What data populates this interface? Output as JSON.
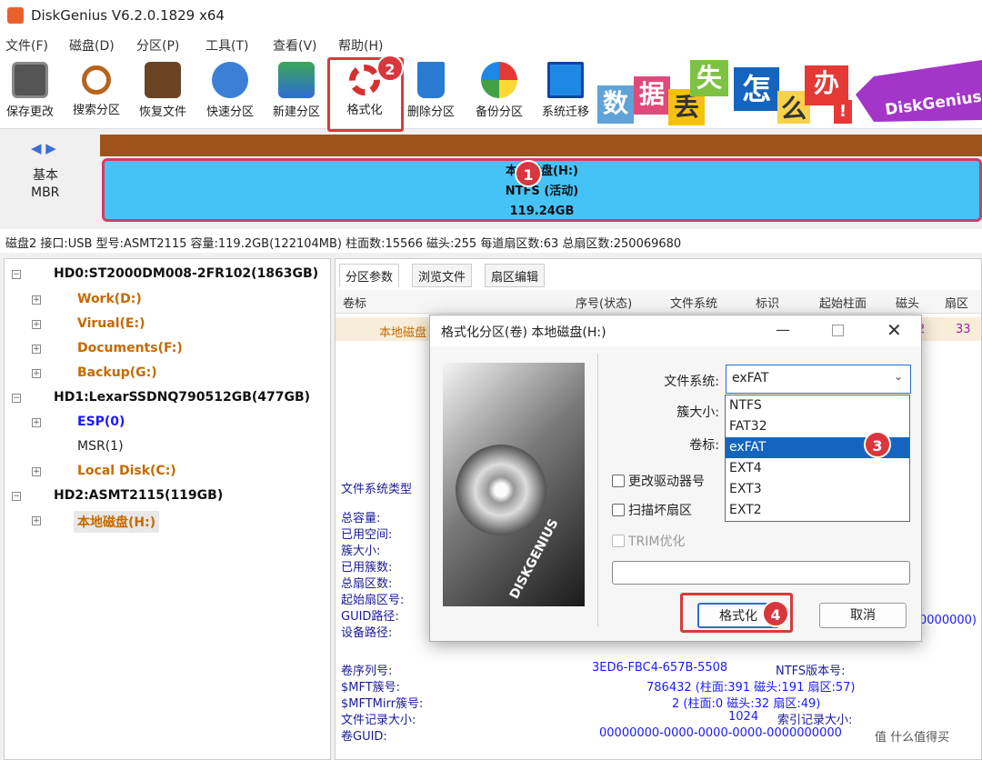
{
  "app": {
    "title": "DiskGenius V6.2.0.1829 x64"
  },
  "menu": [
    "文件(F)",
    "磁盘(D)",
    "分区(P)",
    "工具(T)",
    "查看(V)",
    "帮助(H)"
  ],
  "toolbar": [
    "保存更改",
    "搜索分区",
    "恢复文件",
    "快速分区",
    "新建分区",
    "格式化",
    "删除分区",
    "备份分区",
    "系统迁移"
  ],
  "banner": {
    "chars": [
      "数",
      "据",
      "丢",
      "失",
      "怎",
      "么",
      "办",
      "!"
    ],
    "tag": "DiskGenius"
  },
  "diskmap": {
    "nav": "◀ ▶",
    "type": "基本",
    "scheme": "MBR",
    "part_name": "本地磁盘(H:)",
    "part_fs": "NTFS (活动)",
    "part_size": "119.24GB"
  },
  "info": "磁盘2 接口:USB  型号:ASMT2115  容量:119.2GB(122104MB)  柱面数:15566  磁头:255  每道扇区数:63  总扇区数:250069680",
  "tree": [
    {
      "label": "HD0:ST2000DM008-2FR102(1863GB)",
      "kind": "d"
    },
    {
      "label": "Work(D:)",
      "kind": "o"
    },
    {
      "label": "Virual(E:)",
      "kind": "o"
    },
    {
      "label": "Documents(F:)",
      "kind": "o"
    },
    {
      "label": "Backup(G:)",
      "kind": "o"
    },
    {
      "label": "HD1:LexarSSDNQ790512GB(477GB)",
      "kind": "d"
    },
    {
      "label": "ESP(0)",
      "kind": "b"
    },
    {
      "label": "MSR(1)",
      "kind": "n"
    },
    {
      "label": "Local Disk(C:)",
      "kind": "o"
    },
    {
      "label": "HD2:ASMT2115(119GB)",
      "kind": "d"
    },
    {
      "label": "本地磁盘(H:)",
      "kind": "o"
    }
  ],
  "tabs": [
    "分区参数",
    "浏览文件",
    "扇区编辑"
  ],
  "table": {
    "headers": [
      "卷标",
      "序号(状态)",
      "文件系统",
      "标识",
      "起始柱面",
      "磁头",
      "扇区"
    ],
    "row_label": "本地磁盘",
    "row_cut": "2",
    "row_sector": "33"
  },
  "params_left": [
    "文件系统类型",
    "总容量:",
    "已用空间:",
    "簇大小:",
    "已用簇数:",
    "总扇区数:",
    "起始扇区号:",
    "GUID路径:",
    "设备路径:"
  ],
  "params_bottom": {
    "labels": [
      "卷序列号:",
      "$MFT簇号:",
      "$MFTMirr簇号:",
      "文件记录大小:",
      "卷GUID:"
    ],
    "values": [
      "3ED6-FBC4-657B-5508",
      "786432 (柱面:391 磁头:191 扇区:57)",
      "2 (柱面:0 磁头:32 扇区:49)",
      "1024",
      "00000000-0000-0000-0000-0000000000"
    ],
    "right": [
      "NTFS版本号:",
      "",
      "",
      "索引记录大小:",
      ""
    ],
    "overflow": "0000000)"
  },
  "dialog": {
    "title": "格式化分区(卷) 本地磁盘(H:)",
    "fs_label": "文件系统:",
    "fs_value": "exFAT",
    "cluster_label": "簇大小:",
    "volume_label": "卷标:",
    "chk1": "更改驱动器号",
    "chk2": "扫描坏扇区",
    "chk3": "TRIM优化",
    "format_btn": "格式化",
    "cancel_btn": "取消",
    "options": [
      "NTFS",
      "FAT32",
      "exFAT",
      "EXT4",
      "EXT3",
      "EXT2"
    ],
    "selected": "exFAT"
  },
  "badges": [
    "1",
    "2",
    "3",
    "4"
  ],
  "watermark": "值 什么值得买",
  "colors": {
    "partition": "#45c3f6",
    "highlight": "#d63b3b",
    "selected": "#1565c0",
    "orange_text": "#c56a00"
  }
}
